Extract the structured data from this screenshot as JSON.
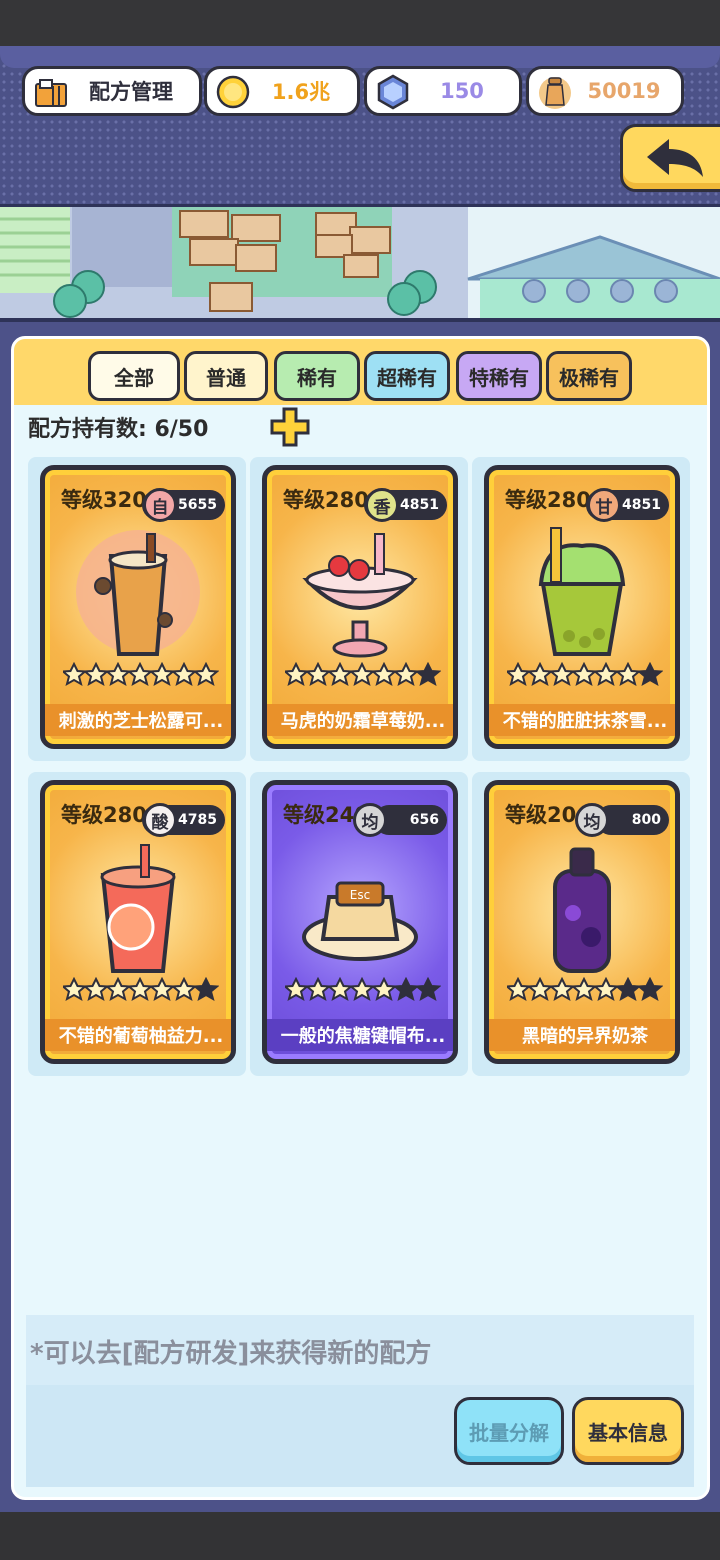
{
  "header": {
    "title": "配方管理",
    "coins": "1.6兆",
    "gems": "150",
    "bottles": "50019"
  },
  "tabs": [
    {
      "label": "全部",
      "color": "#fffbe8"
    },
    {
      "label": "普通",
      "color": "#fff4cc"
    },
    {
      "label": "稀有",
      "color": "#b7ecb0"
    },
    {
      "label": "超稀有",
      "color": "#9ee0f4"
    },
    {
      "label": "特稀有",
      "color": "#c7a8f4"
    },
    {
      "label": "极稀有",
      "color": "#f7c15c"
    }
  ],
  "owned": "配方持有数: 6/50",
  "cards": [
    {
      "level": "等级320",
      "flavor": "自",
      "flavor_color": "#f3a7a7",
      "score": "5655",
      "stars": 7,
      "name": "刺激的芝士松露可...",
      "rarity": "gold",
      "art": "truffle-coffee"
    },
    {
      "level": "等级280",
      "flavor": "香",
      "flavor_color": "#dfe38a",
      "score": "4851",
      "stars": 6,
      "name": "马虎的奶霜草莓奶...",
      "rarity": "gold",
      "art": "strawberry-sundae"
    },
    {
      "level": "等级280",
      "flavor": "甘",
      "flavor_color": "#f0a87a",
      "score": "4851",
      "stars": 6,
      "name": "不错的脏脏抹茶雪...",
      "rarity": "gold",
      "art": "matcha-frappe"
    },
    {
      "level": "等级280",
      "flavor": "酸",
      "flavor_color": "#f5f0f0",
      "score": "4785",
      "stars": 6,
      "name": "不错的葡萄柚益力...",
      "rarity": "gold",
      "art": "grapefruit-tea"
    },
    {
      "level": "等级240",
      "flavor": "均",
      "flavor_color": "#d6d6d6",
      "score": "656",
      "stars": 5,
      "name": "一般的焦糖键帽布...",
      "rarity": "purple",
      "art": "caramel-pudding"
    },
    {
      "level": "等级20",
      "flavor": "均",
      "flavor_color": "#d6d6d6",
      "score": "800",
      "stars": 5,
      "name": "黑暗的异界奶茶",
      "rarity": "gold",
      "art": "dark-bottle"
    }
  ],
  "tip": "*可以去[配方研发]来获得新的配方",
  "buttons": {
    "batch": "批量分解",
    "info": "基本信息"
  },
  "colors": {
    "coin_text": "#f0a21c",
    "gem_text": "#9a8ae6",
    "bottle_text": "#e7a66b",
    "panel": "#e8f8fd",
    "frame": "#4d5289"
  }
}
